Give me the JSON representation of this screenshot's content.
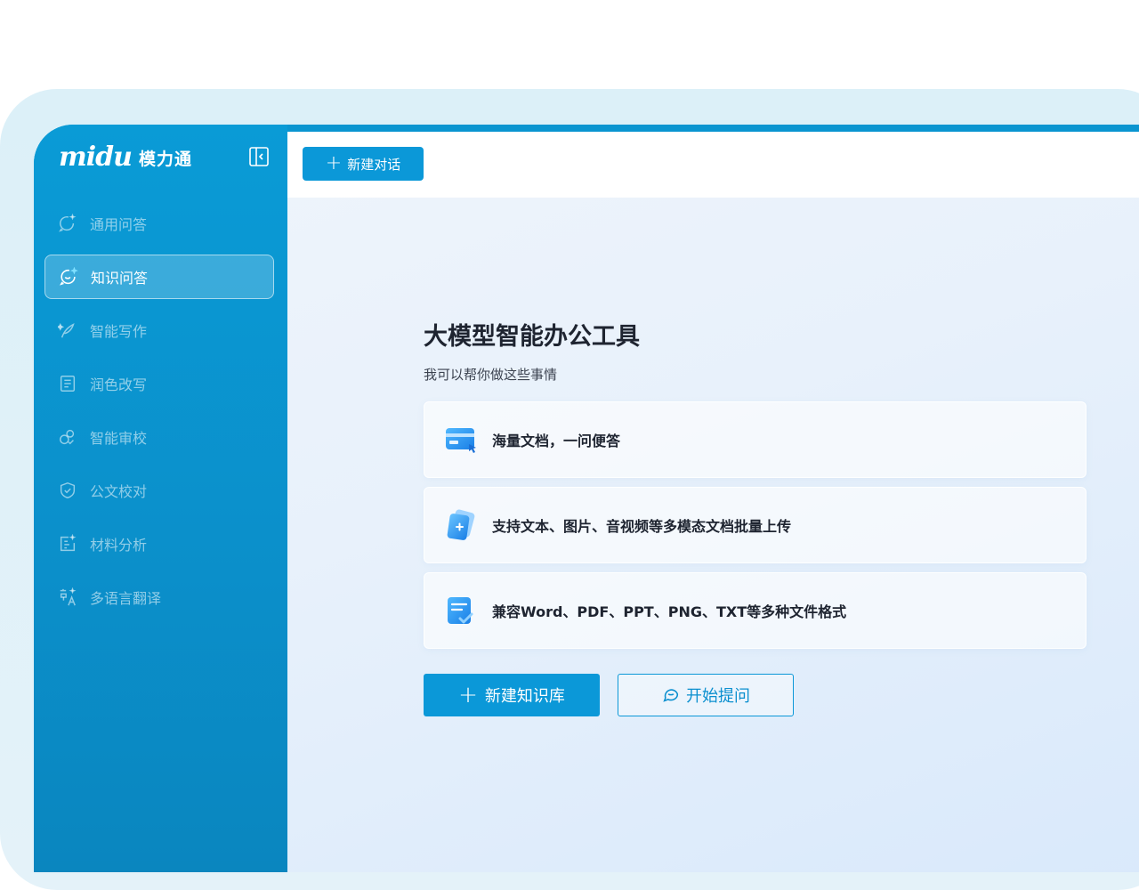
{
  "app": {
    "logo_mark": "midu",
    "logo_name": "模力通"
  },
  "sidebar": {
    "items": [
      {
        "label": "通用问答",
        "icon": "chat-sparkle-icon",
        "active": false
      },
      {
        "label": "知识问答",
        "icon": "smile-chat-icon",
        "active": true
      },
      {
        "label": "智能写作",
        "icon": "quill-icon",
        "active": false
      },
      {
        "label": "润色改写",
        "icon": "document-icon",
        "active": false
      },
      {
        "label": "智能审校",
        "icon": "shapes-check-icon",
        "active": false
      },
      {
        "label": "公文校对",
        "icon": "shield-check-icon",
        "active": false
      },
      {
        "label": "材料分析",
        "icon": "analysis-icon",
        "active": false
      },
      {
        "label": "多语言翻译",
        "icon": "translate-icon",
        "active": false
      }
    ]
  },
  "topbar": {
    "new_chat_label": "新建对话"
  },
  "main": {
    "title": "大模型智能办公工具",
    "subtitle": "我可以帮你做这些事情",
    "features": [
      {
        "text": "海量文档，一问便答",
        "icon": "card-cursor-icon"
      },
      {
        "text": "支持文本、图片、音视频等多模态文档批量上传",
        "icon": "upload-doc-icon"
      },
      {
        "text": "兼容Word、PDF、PPT、PNG、TXT等多种文件格式",
        "icon": "file-format-icon"
      }
    ],
    "new_kb_label": "新建知识库",
    "ask_label": "开始提问"
  },
  "colors": {
    "accent": "#0b98d8",
    "sidebar": "#0a95d0",
    "title": "#1e2430"
  }
}
